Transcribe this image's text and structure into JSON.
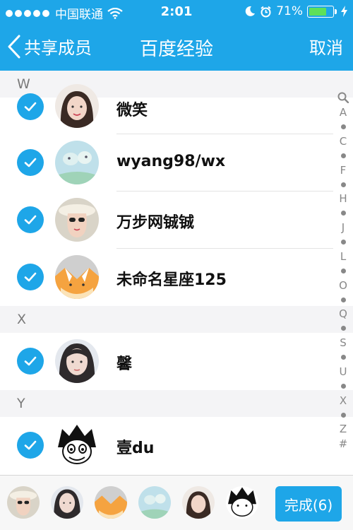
{
  "status_bar": {
    "carrier": "中国联通",
    "time": "2:01",
    "battery_percent": "71%",
    "signal_icon": "signal-dots-icon",
    "wifi_icon": "wifi-icon",
    "moon_icon": "moon-icon",
    "alarm_icon": "alarm-icon",
    "charging_icon": "bolt-icon"
  },
  "nav": {
    "back_label": "共享成员",
    "title": "百度经验",
    "cancel_label": "取消"
  },
  "sections": [
    {
      "letter": "W",
      "members": [
        {
          "name": "微笑",
          "checked": true
        },
        {
          "name": "wyang98/wx",
          "checked": true
        },
        {
          "name": "万步网铖铖",
          "checked": true
        },
        {
          "name": "未命名星座125",
          "checked": true
        }
      ]
    },
    {
      "letter": "X",
      "members": [
        {
          "name": "馨",
          "checked": true
        }
      ]
    },
    {
      "letter": "Y",
      "members": [
        {
          "name": "壹du",
          "checked": true
        }
      ]
    }
  ],
  "index_bar": [
    "Q-icon",
    "A",
    "•",
    "C",
    "•",
    "F",
    "•",
    "H",
    "•",
    "J",
    "•",
    "L",
    "•",
    "O",
    "•",
    "Q",
    "•",
    "S",
    "•",
    "U",
    "•",
    "X",
    "•",
    "Z",
    "#"
  ],
  "index_letters": {
    "a": "A",
    "c": "C",
    "f": "F",
    "h": "H",
    "j": "J",
    "l": "L",
    "o": "O",
    "q": "Q",
    "s": "S",
    "u": "U",
    "x": "X",
    "z": "Z",
    "hash": "#"
  },
  "bottom": {
    "done_label": "完成(6)"
  },
  "colors": {
    "accent": "#1ea6e8",
    "section_bg": "#f4f4f6",
    "battery_fill": "#5ee05a"
  }
}
